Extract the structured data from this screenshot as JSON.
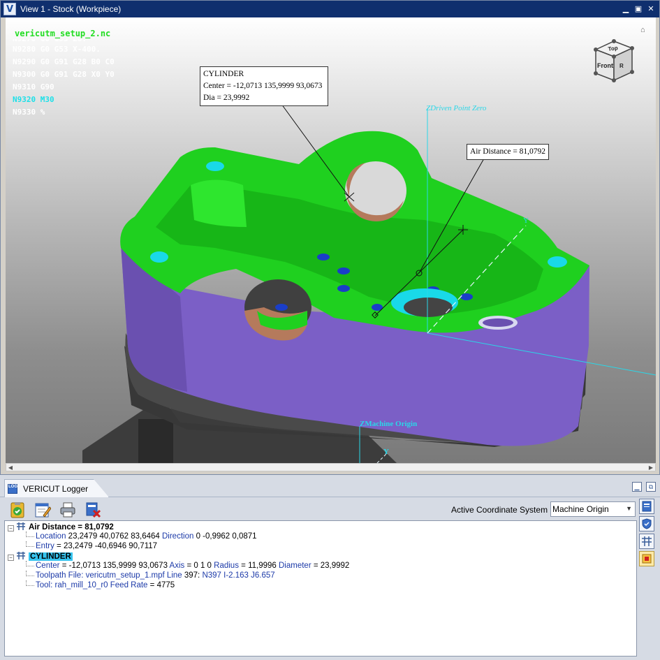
{
  "view": {
    "title": "View 1 - Stock (Workpiece)",
    "app_icon": "V",
    "nc_file": "vericutm_setup_2.nc",
    "nc_lines": [
      {
        "text": "N9270 G0 G53 Z0.",
        "state": "partial"
      },
      {
        "text": "N9280 G0 G53 X-400.",
        "state": "normal"
      },
      {
        "text": "N9290 G0 G91 G28 B0 C0",
        "state": "normal"
      },
      {
        "text": "N9300 G0 G91 G28 X0 Y0",
        "state": "normal"
      },
      {
        "text": "N9310 G90",
        "state": "normal"
      },
      {
        "text": "N9320 M30",
        "state": "active"
      },
      {
        "text": "N9330 %",
        "state": "normal"
      }
    ],
    "callout_cylinder": {
      "title": "CYLINDER",
      "center": "Center = -12,0713 135,9999 93,0673",
      "dia": "Dia = 23,9992"
    },
    "callout_air": "Air Distance = 81,0792",
    "axis_labels": {
      "zdriven": "ZDriven Point Zero",
      "zmachine": "ZMachine Origin",
      "y1": "Y",
      "y2": "Y"
    },
    "view_cube": {
      "top": "Top",
      "front": "Front",
      "right": "R"
    },
    "colors": {
      "stock_green": "#1fd01f",
      "stock_purple": "#7b5fc6",
      "hole_copper": "#b57a5c",
      "hole_cyan": "#19d9e8",
      "axis_cyan": "#2ad7e8"
    },
    "window_controls": [
      "minimize-icon",
      "restore-icon",
      "close-icon"
    ]
  },
  "logger": {
    "tab_label": "VERICUT Logger",
    "toolbar_icons": [
      "clipboard-check-icon",
      "edit-log-icon",
      "print-icon",
      "clear-log-icon"
    ],
    "active_cs_label": "Active Coordinate System",
    "active_cs_value": "Machine Origin",
    "tree": {
      "air": {
        "title": "Air Distance = 81,0792",
        "location_key": "Location",
        "location_val": " 23,2479 40,0762 83,6464 ",
        "direction_key": "Direction",
        "direction_val": " 0 -0,9962 0,0871",
        "entry_key": "Entry",
        "entry_val": " = 23,2479 -40,6946 90,7117"
      },
      "cylinder": {
        "title": "CYLINDER",
        "center_key": "Center",
        "center_val": " = -12,0713 135,9999 93,0673 ",
        "axis_key": "Axis",
        "axis_val": " = 0 1 0 ",
        "radius_key": "Radius",
        "radius_val": " = 11,9996 ",
        "diameter_key": "Diameter",
        "diameter_val": " = 23,9992",
        "toolpath_key": "Toolpath File: vericutm_setup_1.mpf",
        "line_key": " Line",
        "line_val": " 397: ",
        "block_key": "N397 I-2.163 J6.657",
        "tool_key": "Tool: rah_mill_10_r0",
        "feed_key": " Feed Rate",
        "feed_val": " = 4775"
      }
    },
    "right_tools": [
      "logger-icon",
      "shield-icon",
      "measure-icon",
      "highlight-icon"
    ]
  }
}
